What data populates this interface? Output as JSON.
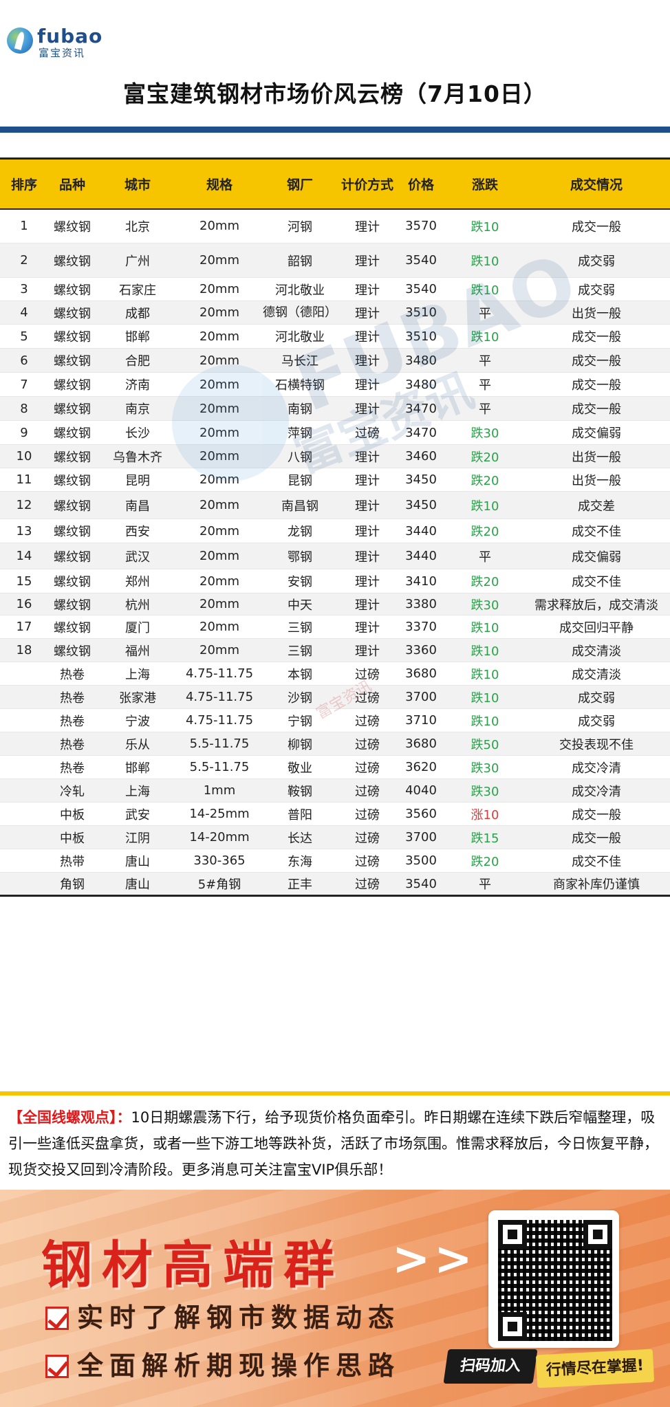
{
  "header": {
    "logo_en": "fubao",
    "logo_cn": "富宝资讯",
    "title": "富宝建筑钢材市场价风云榜（7月10日）"
  },
  "table": {
    "columns": [
      "排序",
      "品种",
      "城市",
      "规格",
      "钢厂",
      "计价方式",
      "价格",
      "涨跌",
      "成交情况"
    ],
    "rows": [
      {
        "rank": "1",
        "product": "螺纹钢",
        "city": "北京",
        "spec": "20mm",
        "mill": "河钢",
        "pricing": "理计",
        "price": "3570",
        "change": "跌10",
        "deal": "成交一般"
      },
      {
        "rank": "2",
        "product": "螺纹钢",
        "city": "广州",
        "spec": "20mm",
        "mill": "韶钢",
        "pricing": "理计",
        "price": "3540",
        "change": "跌10",
        "deal": "成交弱"
      },
      {
        "rank": "3",
        "product": "螺纹钢",
        "city": "石家庄",
        "spec": "20mm",
        "mill": "河北敬业",
        "pricing": "理计",
        "price": "3540",
        "change": "跌10",
        "deal": "成交弱"
      },
      {
        "rank": "4",
        "product": "螺纹钢",
        "city": "成都",
        "spec": "20mm",
        "mill": "德钢（德阳）",
        "pricing": "理计",
        "price": "3510",
        "change": "平",
        "deal": "出货一般"
      },
      {
        "rank": "5",
        "product": "螺纹钢",
        "city": "邯郸",
        "spec": "20mm",
        "mill": "河北敬业",
        "pricing": "理计",
        "price": "3510",
        "change": "跌10",
        "deal": "成交一般"
      },
      {
        "rank": "6",
        "product": "螺纹钢",
        "city": "合肥",
        "spec": "20mm",
        "mill": "马长江",
        "pricing": "理计",
        "price": "3480",
        "change": "平",
        "deal": "成交一般"
      },
      {
        "rank": "7",
        "product": "螺纹钢",
        "city": "济南",
        "spec": "20mm",
        "mill": "石横特钢",
        "pricing": "理计",
        "price": "3480",
        "change": "平",
        "deal": "成交一般"
      },
      {
        "rank": "8",
        "product": "螺纹钢",
        "city": "南京",
        "spec": "20mm",
        "mill": "南钢",
        "pricing": "理计",
        "price": "3470",
        "change": "平",
        "deal": "成交一般"
      },
      {
        "rank": "9",
        "product": "螺纹钢",
        "city": "长沙",
        "spec": "20mm",
        "mill": "萍钢",
        "pricing": "过磅",
        "price": "3470",
        "change": "跌30",
        "deal": "成交偏弱"
      },
      {
        "rank": "10",
        "product": "螺纹钢",
        "city": "乌鲁木齐",
        "spec": "20mm",
        "mill": "八钢",
        "pricing": "理计",
        "price": "3460",
        "change": "跌20",
        "deal": "出货一般"
      },
      {
        "rank": "11",
        "product": "螺纹钢",
        "city": "昆明",
        "spec": "20mm",
        "mill": "昆钢",
        "pricing": "理计",
        "price": "3450",
        "change": "跌20",
        "deal": "出货一般"
      },
      {
        "rank": "12",
        "product": "螺纹钢",
        "city": "南昌",
        "spec": "20mm",
        "mill": "南昌钢",
        "pricing": "理计",
        "price": "3450",
        "change": "跌10",
        "deal": "成交差"
      },
      {
        "rank": "13",
        "product": "螺纹钢",
        "city": "西安",
        "spec": "20mm",
        "mill": "龙钢",
        "pricing": "理计",
        "price": "3440",
        "change": "跌20",
        "deal": "成交不佳"
      },
      {
        "rank": "14",
        "product": "螺纹钢",
        "city": "武汉",
        "spec": "20mm",
        "mill": "鄂钢",
        "pricing": "理计",
        "price": "3440",
        "change": "平",
        "deal": "成交偏弱"
      },
      {
        "rank": "15",
        "product": "螺纹钢",
        "city": "郑州",
        "spec": "20mm",
        "mill": "安钢",
        "pricing": "理计",
        "price": "3410",
        "change": "跌20",
        "deal": "成交不佳"
      },
      {
        "rank": "16",
        "product": "螺纹钢",
        "city": "杭州",
        "spec": "20mm",
        "mill": "中天",
        "pricing": "理计",
        "price": "3380",
        "change": "跌30",
        "deal": "需求释放后，成交清淡"
      },
      {
        "rank": "17",
        "product": "螺纹钢",
        "city": "厦门",
        "spec": "20mm",
        "mill": "三钢",
        "pricing": "理计",
        "price": "3370",
        "change": "跌10",
        "deal": "成交回归平静"
      },
      {
        "rank": "18",
        "product": "螺纹钢",
        "city": "福州",
        "spec": "20mm",
        "mill": "三钢",
        "pricing": "理计",
        "price": "3360",
        "change": "跌10",
        "deal": "成交清淡"
      },
      {
        "rank": "",
        "product": "热卷",
        "city": "上海",
        "spec": "4.75-11.75",
        "mill": "本钢",
        "pricing": "过磅",
        "price": "3680",
        "change": "跌10",
        "deal": "成交清淡"
      },
      {
        "rank": "",
        "product": "热卷",
        "city": "张家港",
        "spec": "4.75-11.75",
        "mill": "沙钢",
        "pricing": "过磅",
        "price": "3700",
        "change": "跌10",
        "deal": "成交弱"
      },
      {
        "rank": "",
        "product": "热卷",
        "city": "宁波",
        "spec": "4.75-11.75",
        "mill": "宁钢",
        "pricing": "过磅",
        "price": "3710",
        "change": "跌10",
        "deal": "成交弱"
      },
      {
        "rank": "",
        "product": "热卷",
        "city": "乐从",
        "spec": "5.5-11.75",
        "mill": "柳钢",
        "pricing": "过磅",
        "price": "3680",
        "change": "跌50",
        "deal": "交投表现不佳"
      },
      {
        "rank": "",
        "product": "热卷",
        "city": "邯郸",
        "spec": "5.5-11.75",
        "mill": "敬业",
        "pricing": "过磅",
        "price": "3620",
        "change": "跌30",
        "deal": "成交冷清"
      },
      {
        "rank": "",
        "product": "冷轧",
        "city": "上海",
        "spec": "1mm",
        "mill": "鞍钢",
        "pricing": "过磅",
        "price": "4040",
        "change": "跌30",
        "deal": "成交冷清"
      },
      {
        "rank": "",
        "product": "中板",
        "city": "武安",
        "spec": "14-25mm",
        "mill": "普阳",
        "pricing": "过磅",
        "price": "3560",
        "change": "涨10",
        "deal": "成交一般"
      },
      {
        "rank": "",
        "product": "中板",
        "city": "江阴",
        "spec": "14-20mm",
        "mill": "长达",
        "pricing": "过磅",
        "price": "3700",
        "change": "跌15",
        "deal": "成交一般"
      },
      {
        "rank": "",
        "product": "热带",
        "city": "唐山",
        "spec": "330-365",
        "mill": "东海",
        "pricing": "过磅",
        "price": "3500",
        "change": "跌20",
        "deal": "成交不佳"
      },
      {
        "rank": "",
        "product": "角钢",
        "city": "唐山",
        "spec": "5#角钢",
        "mill": "正丰",
        "pricing": "过磅",
        "price": "3540",
        "change": "平",
        "deal": "商家补库仍谨慎"
      }
    ]
  },
  "watermark": {
    "en": "FUBAO",
    "cn": "富宝资讯",
    "small": "富宝资讯"
  },
  "viewpoint": {
    "label": "【全国线螺观点】：",
    "text": "10日期螺震荡下行，给予现货价格负面牵引。昨日期螺在连续下跌后窄幅整理，吸引一些逢低买盘拿货，或者一些下游工地等跌补货，活跃了市场氛围。惟需求释放后，今日恢复平静，现货交投又回到冷清阶段。更多消息可关注富宝VIP俱乐部！"
  },
  "banner": {
    "title": "钢材高端群",
    "arrows": ">>",
    "item1": "实时了解钢市数据动态",
    "item2": "全面解析期现操作思路",
    "scan": "扫码加入",
    "tag": "行情尽在掌握!"
  },
  "colors": {
    "brand": "#1f4e8c",
    "header_yellow": "#f7c400",
    "down_green": "#2ba24a",
    "up_red": "#e03a3a"
  }
}
